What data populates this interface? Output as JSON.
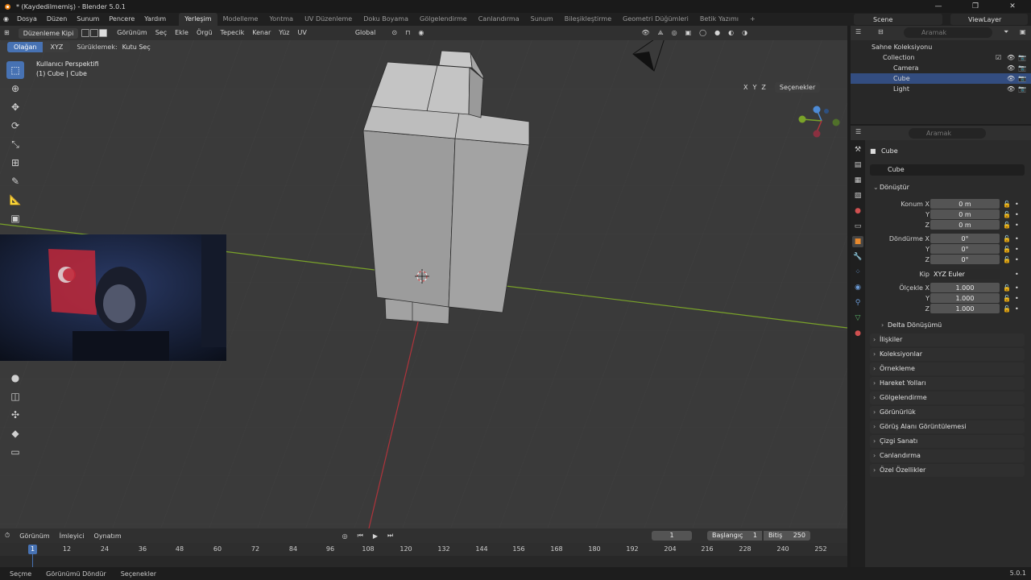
{
  "window": {
    "title": "* (Kaydedilmemiş) - Blender 5.0.1",
    "minimize": "—",
    "maximize": "❐",
    "close": "✕"
  },
  "menu": {
    "items": [
      "Dosya",
      "Düzen",
      "Sunum",
      "Pencere",
      "Yardım"
    ],
    "workspaces": [
      "Yerleşim",
      "Modelleme",
      "Yontma",
      "UV Düzenleme",
      "Doku Boyama",
      "Gölgelendirme",
      "Canlandırma",
      "Sunum",
      "Bileşikleştirme",
      "Geometri Düğümleri",
      "Betik Yazımı"
    ],
    "active_workspace": "Yerleşim",
    "add_tab": "+",
    "scene": "Scene",
    "view_layer": "ViewLayer"
  },
  "viewport_header": {
    "mode": "Düzenleme Kipi",
    "menus": [
      "Görünüm",
      "Seç",
      "Ekle",
      "Örgü",
      "Tepecik",
      "Kenar",
      "Yüz",
      "UV"
    ],
    "orientation": "Global",
    "options_label": "Seçenekler",
    "axes": [
      "X",
      "Y",
      "Z"
    ]
  },
  "tool_header": {
    "mode_normal": "Olağan",
    "mode_xyz": "XYZ",
    "drag_label": "Sürüklemek:",
    "drag_value": "Kutu Seç"
  },
  "viewport_info": {
    "line1": "Kullanıcı Perspektifi",
    "line2": "(1) Cube | Cube"
  },
  "icons": {
    "toolbar": [
      "select-box-icon",
      "cursor-icon",
      "move-icon",
      "rotate-icon",
      "scale-icon",
      "transform-icon",
      "annotate-icon",
      "measure-icon",
      "add-cube-icon"
    ],
    "toolbar_lower": [
      "spin-icon",
      "smooth-icon",
      "shrink-fatten-icon",
      "shear-icon",
      "rip-icon",
      "edge-slide-icon"
    ]
  },
  "timeline": {
    "menus": [
      "Görünüm",
      "İmleyici",
      "Oynatım"
    ],
    "current_frame": "1",
    "start_label": "Başlangıç",
    "start_value": "1",
    "end_label": "Bitiş",
    "end_value": "250",
    "ticks": [
      "1",
      "12",
      "24",
      "36",
      "48",
      "60",
      "72",
      "84",
      "96",
      "108",
      "120",
      "132",
      "144",
      "156",
      "168",
      "180",
      "192",
      "204",
      "216",
      "228",
      "240",
      "252"
    ]
  },
  "status": {
    "select": "Seçme",
    "rotate_view": "Görünümü Döndür",
    "options": "Seçenekler",
    "version": "5.0.1"
  },
  "outliner": {
    "search_placeholder": "Aramak",
    "items": [
      {
        "label": "Sahne Koleksiyonu"
      },
      {
        "label": "Collection"
      },
      {
        "label": "Camera"
      },
      {
        "label": "Cube"
      },
      {
        "label": "Light"
      }
    ]
  },
  "properties": {
    "search_placeholder": "Aramak",
    "object_name": "Cube",
    "datablock": "Cube",
    "transform_title": "Dönüştür",
    "location_label": "Konum X",
    "y_label": "Y",
    "z_label": "Z",
    "location": [
      "0 m",
      "0 m",
      "0 m"
    ],
    "rotation_label": "Döndürme X",
    "rotation": [
      "0°",
      "0°",
      "0°"
    ],
    "mode_label": "Kip",
    "mode_value": "XYZ Euler",
    "scale_label": "Ölçekle X",
    "scale": [
      "1.000",
      "1.000",
      "1.000"
    ],
    "delta": "Delta Dönüşümü",
    "panels": [
      "İlişkiler",
      "Koleksiyonlar",
      "Örnekleme",
      "Hareket Yolları",
      "Gölgelendirme",
      "Görünürlük",
      "Görüş Alanı Görüntülemesi",
      "Çizgi Sanatı",
      "Canlandırma",
      "Özel Özellikler"
    ]
  },
  "colors": {
    "accent": "#4772b3",
    "viewport_bg": "#3a3a3a",
    "x_axis": "#b0343c",
    "y_axis": "#7aa329"
  }
}
